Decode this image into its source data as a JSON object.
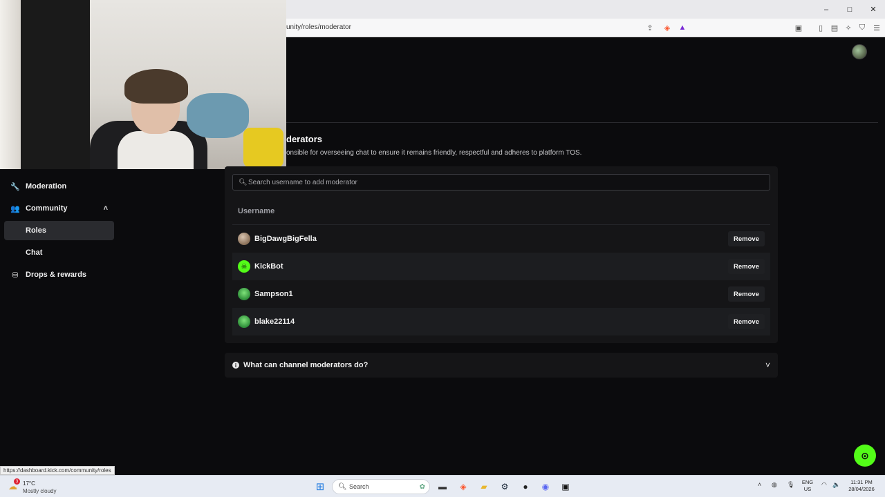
{
  "browser": {
    "url": "unity/roles/moderator",
    "status_url": "https://dashboard.kick.com/community/roles",
    "window_controls": [
      "–",
      "□",
      "✕"
    ]
  },
  "header": {
    "title": "derators",
    "description": "onsible for overseeing chat to ensure it remains friendly, respectful and adheres to platform TOS."
  },
  "sidebar": {
    "items": [
      {
        "label": "Moderation",
        "icon": "wrench-icon",
        "glyph": "🔧"
      },
      {
        "label": "Community",
        "icon": "people-icon",
        "glyph": "👥",
        "chevron": "˄"
      },
      {
        "label": "Roles"
      },
      {
        "label": "Chat"
      },
      {
        "label": "Drops & rewards",
        "icon": "gift-icon",
        "glyph": "🎁"
      }
    ]
  },
  "moderators": {
    "search_placeholder": "Search username to add moderator",
    "column_username": "Username",
    "rows": [
      {
        "username": "BigDawgBigFella",
        "action": "Remove",
        "avatar_color": "#8a7058"
      },
      {
        "username": "KickBot",
        "action": "Remove",
        "avatar_color": "#53fc18"
      },
      {
        "username": "Sampson1",
        "action": "Remove",
        "avatar_color": "#3aa84a"
      },
      {
        "username": "blake22114",
        "action": "Remove",
        "avatar_color": "#3aa84a"
      }
    ]
  },
  "faq": {
    "question": "What can channel moderators do?",
    "info_glyph": "i",
    "chevron": "˅"
  },
  "help_glyph": "⊙",
  "taskbar": {
    "weather_temp": "17°C",
    "weather_cond": "Mostly cloudy",
    "weather_badge": "3",
    "search_label": "Search",
    "lang_line1": "ENG",
    "lang_line2": "US",
    "time": "11:31 PM",
    "date": "28/04/2026"
  },
  "colors": {
    "accent": "#53fc18",
    "background": "#0b0b0d",
    "card": "#151517"
  }
}
